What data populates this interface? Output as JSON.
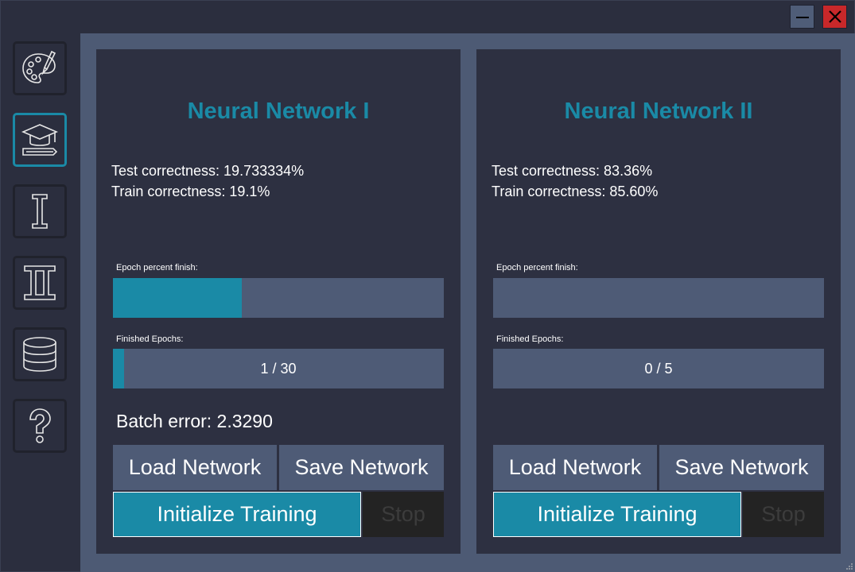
{
  "titlebar": {
    "minimize_icon": "minimize-icon",
    "close_icon": "close-icon"
  },
  "sidebar": {
    "items": [
      {
        "id": "draw",
        "icon": "palette-icon",
        "active": false
      },
      {
        "id": "train",
        "icon": "graduation-cap-icon",
        "active": true
      },
      {
        "id": "network-1",
        "icon": "roman-one-icon",
        "active": false
      },
      {
        "id": "network-2",
        "icon": "roman-two-icon",
        "active": false
      },
      {
        "id": "dataset",
        "icon": "database-icon",
        "active": false
      },
      {
        "id": "help",
        "icon": "question-mark-icon",
        "active": false
      }
    ]
  },
  "colors": {
    "accent": "#1a8aa6",
    "panel": "#2d3041",
    "bar_bg": "#4e5b76",
    "close": "#c8282a"
  },
  "networks": [
    {
      "title": "Neural Network I",
      "test_correctness": "Test correctness:  19.733334%",
      "train_correctness": "Train correctness: 19.1%",
      "epoch_percent_label": "Epoch percent finish:",
      "epoch_percent_value": 0.39,
      "finished_epochs_label": "Finished Epochs:",
      "finished_epochs_text": "1 / 30",
      "finished_epochs_value": 0.033,
      "batch_error": "Batch error: 2.3290",
      "load_label": "Load Network",
      "save_label": "Save Network",
      "init_label": "Initialize Training",
      "stop_label": "Stop"
    },
    {
      "title": "Neural Network II",
      "test_correctness": "Test correctness:  83.36%",
      "train_correctness": "Train correctness: 85.60%",
      "epoch_percent_label": "Epoch percent finish:",
      "epoch_percent_value": 0,
      "finished_epochs_label": "Finished Epochs:",
      "finished_epochs_text": "0 / 5",
      "finished_epochs_value": 0,
      "batch_error": "",
      "load_label": "Load Network",
      "save_label": "Save Network",
      "init_label": "Initialize Training",
      "stop_label": "Stop"
    }
  ]
}
